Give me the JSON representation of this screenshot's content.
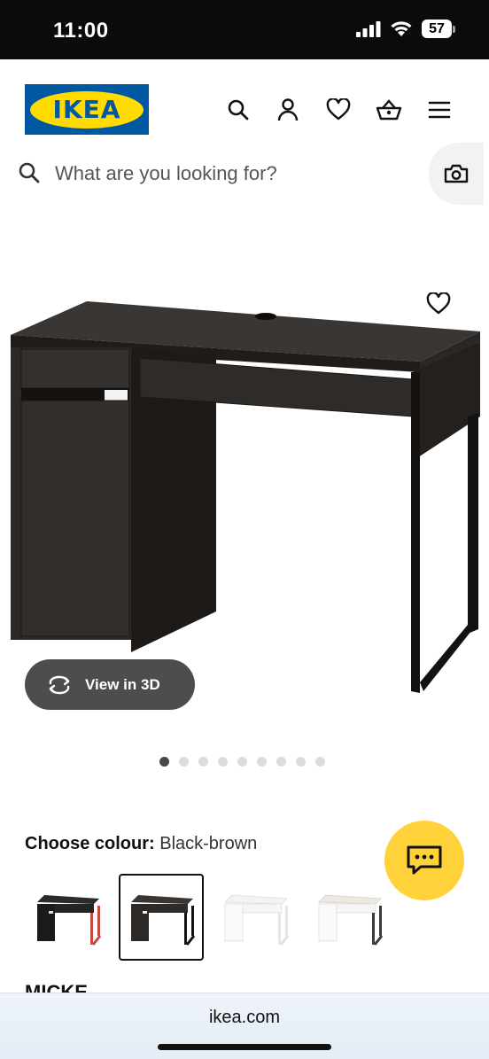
{
  "status_bar": {
    "time": "11:00",
    "battery": "57",
    "icons": [
      "cellular-signal-icon",
      "wifi-icon",
      "battery-icon"
    ]
  },
  "header": {
    "logo_text": "IKEA",
    "brand_colors": {
      "blue": "#0058a3",
      "yellow": "#ffdb00"
    },
    "nav_icons": [
      "search-icon",
      "account-icon",
      "favourites-icon",
      "basket-icon",
      "menu-icon"
    ]
  },
  "search": {
    "placeholder": "What are you looking for?",
    "camera_icon": "camera-icon"
  },
  "product": {
    "image_description_icon": "product-image-desk",
    "view_3d_label": "View in 3D",
    "carousel": {
      "total": 9,
      "active": 1
    },
    "colour_label": "Choose colour:",
    "colour_value": "Black-brown",
    "swatches": [
      {
        "name": "Black/red",
        "selected": false
      },
      {
        "name": "Black-brown",
        "selected": true
      },
      {
        "name": "White",
        "selected": false
      },
      {
        "name": "White/anthracite",
        "selected": false
      }
    ],
    "name_partial": "MICKE"
  },
  "chat": {
    "icon": "chat-icon",
    "color": "#ffd23a"
  },
  "browser": {
    "url": "ikea.com"
  }
}
